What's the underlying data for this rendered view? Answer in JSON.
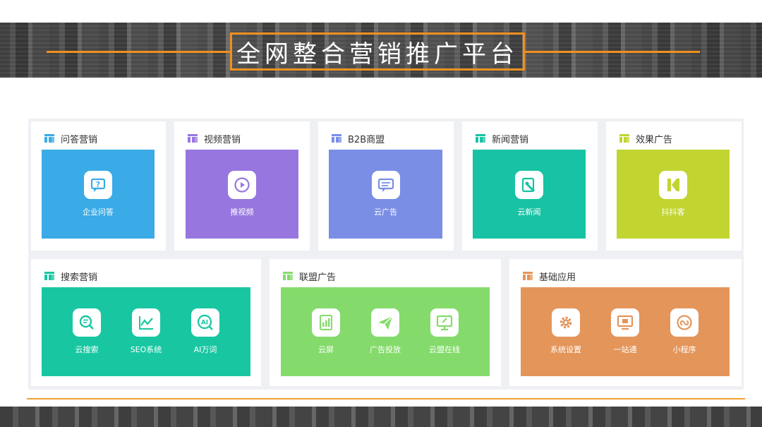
{
  "banner": {
    "title": "全网整合营销推广平台"
  },
  "colors": {
    "accent": "#f0901e",
    "wenda": "#3aabe6",
    "video": "#9777df",
    "b2b": "#7a8ee6",
    "news": "#17c3a4",
    "effect": "#c2d430",
    "search": "#18c7a2",
    "alliance": "#84db6c",
    "basic": "#e4955a"
  },
  "top_cards": [
    {
      "title": "问答营销",
      "icon": "layout-icon",
      "items": [
        {
          "label": "企业问答",
          "icon": "question-chat-icon"
        }
      ]
    },
    {
      "title": "视频营销",
      "icon": "layout-icon",
      "items": [
        {
          "label": "推视频",
          "icon": "play-icon"
        }
      ]
    },
    {
      "title": "B2B商盟",
      "icon": "layout-icon",
      "items": [
        {
          "label": "云广告",
          "icon": "message-icon"
        }
      ]
    },
    {
      "title": "新闻营销",
      "icon": "layout-icon",
      "items": [
        {
          "label": "云新闻",
          "icon": "news-icon"
        }
      ]
    },
    {
      "title": "效果广告",
      "icon": "layout-icon",
      "items": [
        {
          "label": "抖抖客",
          "icon": "k-logo-icon"
        }
      ]
    }
  ],
  "bottom_cards": [
    {
      "title": "搜索营销",
      "icon": "layout-icon",
      "items": [
        {
          "label": "云搜索",
          "icon": "search-icon"
        },
        {
          "label": "SEO系统",
          "icon": "line-chart-icon"
        },
        {
          "label": "AI万词",
          "icon": "ai-search-icon"
        }
      ]
    },
    {
      "title": "联盟广告",
      "icon": "layout-icon",
      "items": [
        {
          "label": "云屏",
          "icon": "screen-chart-icon"
        },
        {
          "label": "广告投放",
          "icon": "send-icon"
        },
        {
          "label": "云盟在线",
          "icon": "monitor-icon"
        }
      ]
    },
    {
      "title": "基础应用",
      "icon": "layout-icon",
      "items": [
        {
          "label": "系统设置",
          "icon": "gear-icon"
        },
        {
          "label": "一站通",
          "icon": "tv-icon"
        },
        {
          "label": "小程序",
          "icon": "mini-program-icon"
        }
      ]
    }
  ]
}
